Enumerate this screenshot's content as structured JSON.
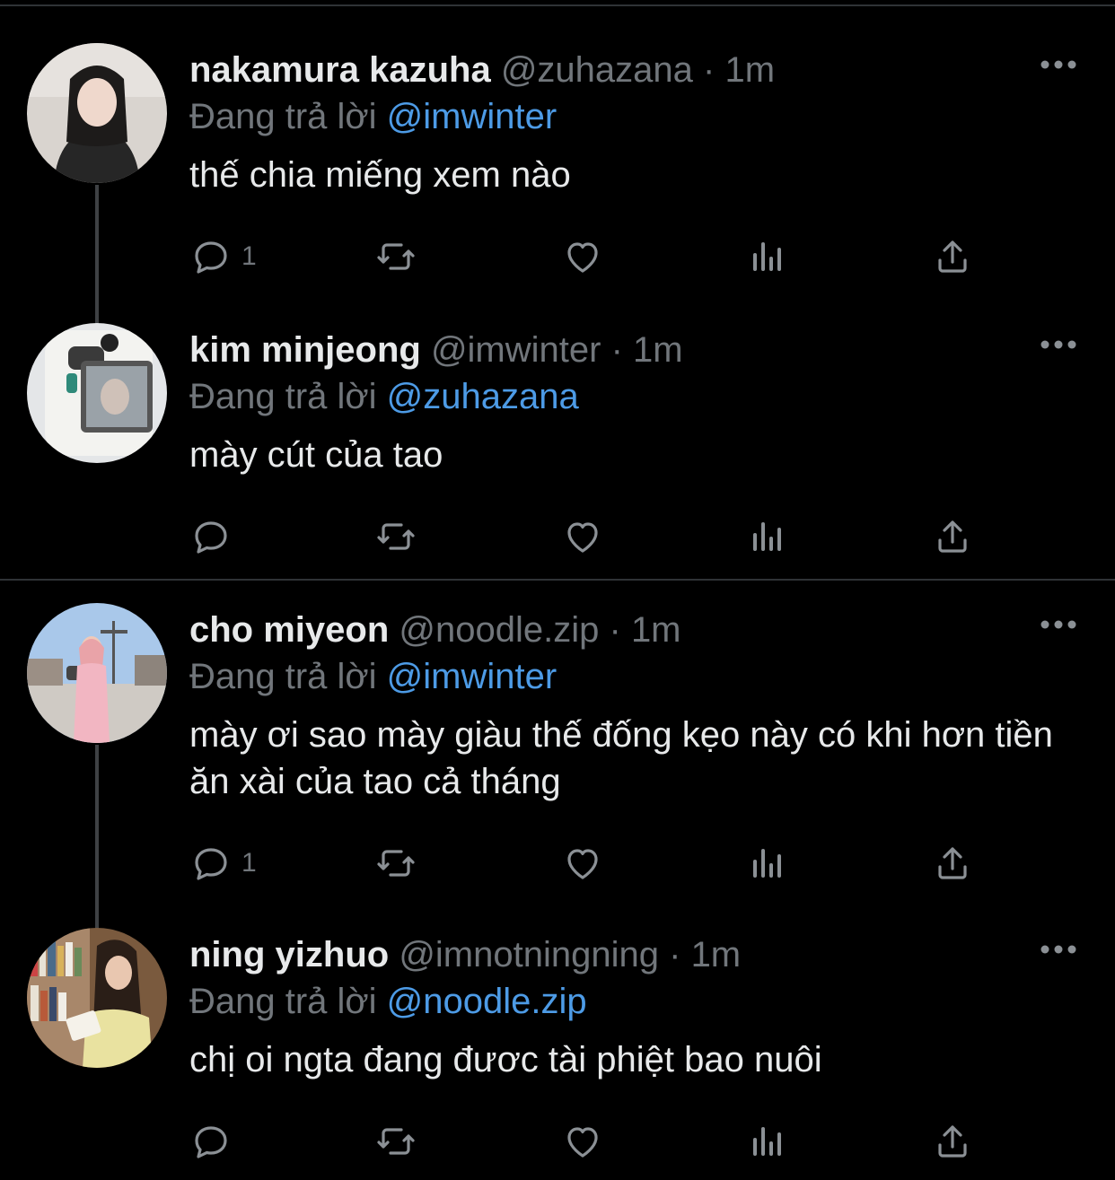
{
  "ui": {
    "colors": {
      "background": "#000000",
      "text": "#e7e9ea",
      "muted": "#71767b",
      "mention": "#4d9be6",
      "divider": "#2f3336"
    },
    "reply_prefix": "Đang trả lời",
    "separator": "·"
  },
  "tweets": [
    {
      "name": "nakamura kazuha",
      "handle": "@zuhazana",
      "time": "1m",
      "replying_to": "@imwinter",
      "text": "thế chia miếng xem nào",
      "reply_count": "1",
      "avatar_icon": "avatar-photo"
    },
    {
      "name": "kim minjeong",
      "handle": "@imwinter",
      "time": "1m",
      "replying_to": "@zuhazana",
      "text": "mày cút của tao",
      "reply_count": "",
      "avatar_icon": "avatar-photo"
    },
    {
      "name": "cho miyeon",
      "handle": "@noodle.zip",
      "time": "1m",
      "replying_to": "@imwinter",
      "text": "mày ơi sao mày giàu thế đống kẹo này có khi hơn tiền ăn xài của tao cả tháng",
      "reply_count": "1",
      "avatar_icon": "avatar-photo"
    },
    {
      "name": "ning yizhuo",
      "handle": "@imnotningning",
      "time": "1m",
      "replying_to": "@noodle.zip",
      "text": "chị oi ngta đang đươc tài phiệt bao nuôi",
      "reply_count": "",
      "avatar_icon": "avatar-photo"
    }
  ]
}
